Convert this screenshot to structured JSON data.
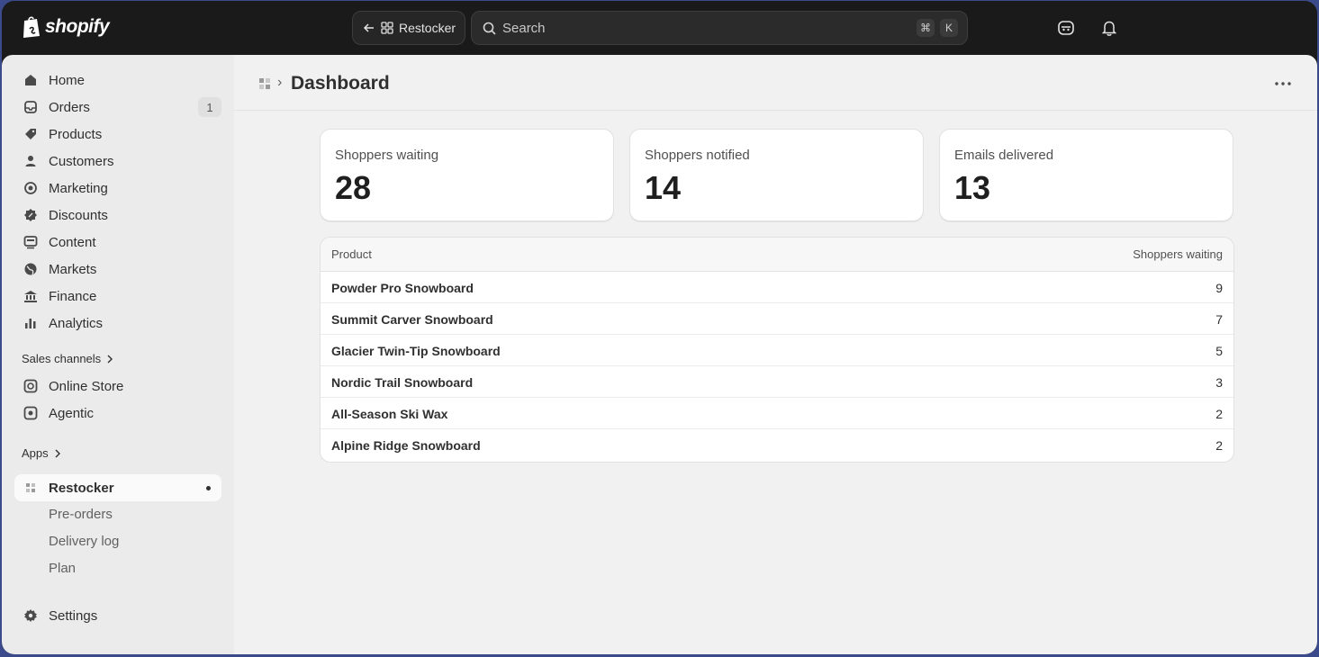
{
  "topbar": {
    "brand": "shopify",
    "app_pill_label": "Restocker",
    "search_placeholder": "Search",
    "shortcut_mod": "⌘",
    "shortcut_key": "K"
  },
  "sidebar": {
    "items": [
      {
        "label": "Home",
        "icon": "home-icon"
      },
      {
        "label": "Orders",
        "icon": "orders-icon",
        "badge": "1"
      },
      {
        "label": "Products",
        "icon": "tag-icon"
      },
      {
        "label": "Customers",
        "icon": "person-icon"
      },
      {
        "label": "Marketing",
        "icon": "target-icon"
      },
      {
        "label": "Discounts",
        "icon": "discount-icon"
      },
      {
        "label": "Content",
        "icon": "content-icon"
      },
      {
        "label": "Markets",
        "icon": "globe-icon"
      },
      {
        "label": "Finance",
        "icon": "bank-icon"
      },
      {
        "label": "Analytics",
        "icon": "bar-chart-icon"
      }
    ],
    "sales_channels_label": "Sales channels",
    "channels": [
      {
        "label": "Online Store",
        "icon": "store-icon"
      },
      {
        "label": "Agentic",
        "icon": "agentic-icon"
      }
    ],
    "apps_label": "Apps",
    "app": {
      "label": "Restocker",
      "icon": "app-icon"
    },
    "app_subitems": [
      "Pre-orders",
      "Delivery log",
      "Plan"
    ],
    "settings_label": "Settings"
  },
  "page": {
    "title": "Dashboard"
  },
  "stats": [
    {
      "label": "Shoppers waiting",
      "value": "28"
    },
    {
      "label": "Shoppers notified",
      "value": "14"
    },
    {
      "label": "Emails delivered",
      "value": "13"
    }
  ],
  "table": {
    "columns": [
      "Product",
      "Shoppers waiting"
    ],
    "rows": [
      {
        "product": "Powder Pro Snowboard",
        "count": "9"
      },
      {
        "product": "Summit Carver Snowboard",
        "count": "7"
      },
      {
        "product": "Glacier Twin-Tip Snowboard",
        "count": "5"
      },
      {
        "product": "Nordic Trail Snowboard",
        "count": "3"
      },
      {
        "product": "All-Season Ski Wax",
        "count": "2"
      },
      {
        "product": "Alpine Ridge Snowboard",
        "count": "2"
      }
    ]
  }
}
